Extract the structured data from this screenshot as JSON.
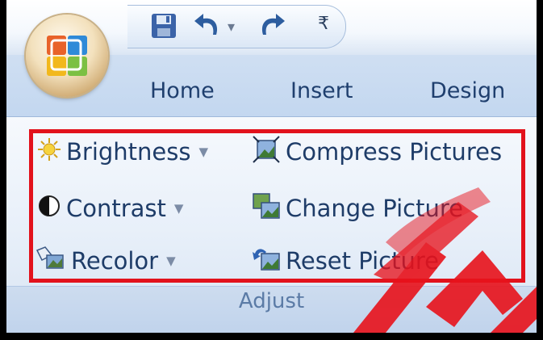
{
  "quick_access": {
    "save_icon": "save-icon",
    "undo_icon": "undo-icon",
    "undo_dropdown": "▾",
    "redo_icon": "redo-icon",
    "customize_glyph": "₹"
  },
  "tabs": [
    "Home",
    "Insert",
    "Design"
  ],
  "adjust_group": {
    "label": "Adjust",
    "commands": {
      "brightness": "Brightness",
      "contrast": "Contrast",
      "recolor": "Recolor",
      "compress": "Compress Pictures",
      "change": "Change Picture",
      "reset": "Reset Picture"
    },
    "dropdown_arrow": "▼"
  },
  "colors": {
    "highlight_border": "#e2121c",
    "tab_text": "#1f3f6e",
    "command_text": "#1e3c68",
    "group_label": "#5b7ba6",
    "watermark": "#e8121b"
  }
}
